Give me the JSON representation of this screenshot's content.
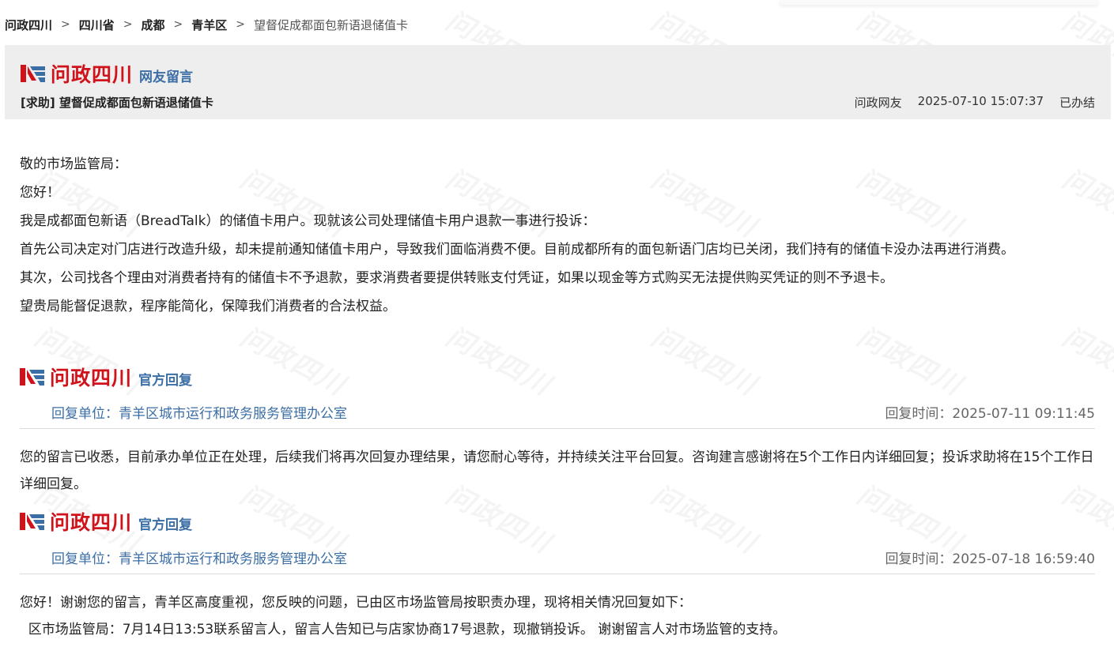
{
  "breadcrumb": {
    "items": [
      "问政四川",
      "四川省",
      "成都",
      "青羊区"
    ],
    "current": "望督促成都面包新语退储值卡",
    "separator": ">"
  },
  "brand": {
    "name": "问政四川",
    "color": "#d0121b",
    "accent": "#3b6ea5"
  },
  "post": {
    "section_label": "网友留言",
    "title": "[求助] 望督促成都面包新语退储值卡",
    "author": "问政网友",
    "datetime": "2025-07-10 15:07:37",
    "status": "已办结",
    "body": [
      "敬的市场监管局：",
      "您好！",
      "我是成都面包新语（BreadTalk）的储值卡用户。现就该公司处理储值卡用户退款一事进行投诉：",
      "首先公司决定对门店进行改造升级，却未提前通知储值卡用户，导致我们面临消费不便。目前成都所有的面包新语门店均已关闭，我们持有的储值卡没办法再进行消费。",
      "其次，公司找各个理由对消费者持有的储值卡不予退款，要求消费者要提供转账支付凭证，如果以现金等方式购买无法提供购买凭证的则不予退卡。",
      "望贵局能督促退款，程序能简化，保障我们消费者的合法权益。"
    ]
  },
  "replies": [
    {
      "section_label": "官方回复",
      "unit_label": "回复单位：青羊区城市运行和政务服务管理办公室",
      "time_label": "回复时间：2025-07-11 09:11:45",
      "text": [
        "您的留言已收悉，目前承办单位正在处理，后续我们将再次回复办理结果，请您耐心等待，并持续关注平台回复。咨询建言感谢将在5个工作日内详细回复；投诉求助将在15个工作日详细回复。"
      ]
    },
    {
      "section_label": "官方回复",
      "unit_label": "回复单位：青羊区城市运行和政务服务管理办公室",
      "time_label": "回复时间：2025-07-18 16:59:40",
      "text": [
        "您好！谢谢您的留言，青羊区高度重视，您反映的问题，已由区市场监管局按职责办理，现将相关情况回复如下：",
        "  区市场监管局：7月14日13:53联系留言人，留言人告知已与店家协商17号退款，现撤销投诉。 谢谢留言人对市场监管的支持。"
      ]
    }
  ],
  "watermark_text": "问政四川"
}
